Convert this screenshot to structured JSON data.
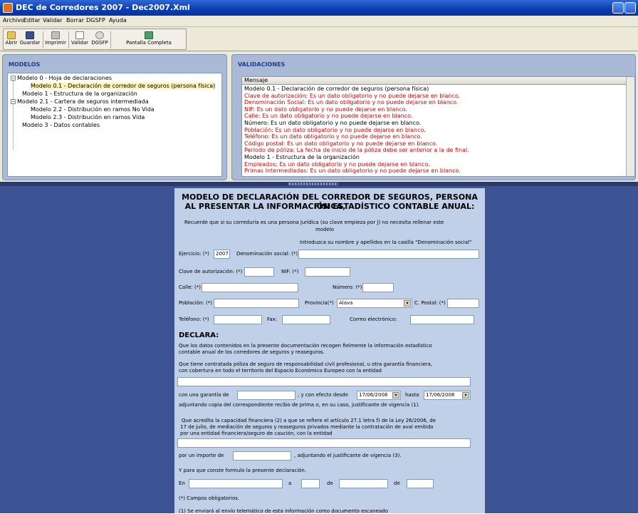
{
  "window": {
    "title": "DEC de Corredores 2007 - Dec2007.Xml"
  },
  "menu": [
    "Archivo",
    "Editar",
    "Validar",
    "Borrar",
    "DGSFP",
    "Ayuda"
  ],
  "toolbar": [
    "Abrir",
    "Guardar",
    "Imprimir",
    "Validar",
    "DGSFP",
    "Pantalla Completa"
  ],
  "modelos": {
    "header": "MODELOS",
    "items": [
      "Modelo 0 - Hoja de declaraciones",
      "Modelo 0.1 - Declaración de corredor de seguros (persona física)",
      "Modelo 1 - Estructura de la organización",
      "Modelo 2.1 - Cartera de seguros intermediada",
      "Modelo 2.2 - Distribución en ramos No Vida",
      "Modelo 2.3 - Distribución en ramos Vida",
      "Modelo 3 - Datos contables"
    ]
  },
  "validaciones": {
    "header": "VALIDACIONES",
    "column": "Mensaje",
    "rows": [
      {
        "text": "Modelo 0.1 - Declaración de corredor de seguros (persona física)",
        "color": "#000000"
      },
      {
        "text": "Clave de autorización: Es un dato obligatorio y no puede dejarse en blanco.",
        "color": "#e00000"
      },
      {
        "text": "Denominación Social: Es un dato obligatorio y no puede dejarse en blanco.",
        "color": "#e00000"
      },
      {
        "text": "NIF: Es un dato obligatorio y no puede dejarse en blanco.",
        "color": "#e00000"
      },
      {
        "text": "Calle: Es un dato obligatorio y no puede dejarse en blanco.",
        "color": "#e00000"
      },
      {
        "text": "Número: Es un dato obligatorio y no puede dejarse en blanco.",
        "color": "#000000"
      },
      {
        "text": "Población: Es un dato obligatorio y no puede dejarse en blanco.",
        "color": "#e00000"
      },
      {
        "text": "Teléfono: Es un dato obligatorio y no puede dejarse en blanco.",
        "color": "#e00000"
      },
      {
        "text": "Código postal: Es un dato obligatorio y no puede dejarse en blanco.",
        "color": "#e00000"
      },
      {
        "text": "Periodo de póliza: La fecha de inicio de la póliza debe ser anterior a la de final.",
        "color": "#e00000"
      },
      {
        "text": "Modelo 1 - Estructura de la organización",
        "color": "#000000"
      },
      {
        "text": "Empleados: Es un dato obligatorio y no puede dejarse en blanco.",
        "color": "#e00000"
      },
      {
        "text": "Primas Intermediadas: Es un dato obligatorio y no puede dejarse en blanco.",
        "color": "#e00000"
      }
    ]
  },
  "form": {
    "title1": "MODELO DE DECLARACIÓN DEL CORREDOR DE SEGUROS, PERSONA FÍSICA,",
    "title2": "AL PRESENTAR LA INFORMACIÓN ESTADÍSTICO CONTABLE ANUAL:",
    "note1": "Recuerde que si su correduría es una persona jurídica (su clave empieza por J) no necesita rellenar este",
    "note2": "modelo",
    "hint": "Introduzca su nombre y apellidos en la casilla \"Denominación social\"",
    "ejercicio_label": "Ejercicio: (*)",
    "ejercicio_value": "2007",
    "denominacion_label": "Denominación social: (*)",
    "clave_label": "Clave de autorización: (*)",
    "nif_label": "NIF: (*)",
    "calle_label": "Calle: (*)",
    "numero_label": "Número: (*)",
    "poblacion_label": "Población: (*)",
    "provincia_label": "Provincia(*)",
    "provincia_value": "Alava",
    "cpostal_label": "C. Postal: (*)",
    "telefono_label": "Teléfono: (*)",
    "fax_label": "Fax:",
    "correo_label": "Correo electrónico:",
    "declara": "DECLARA:",
    "p1a": "Que los datos contenidos en la presente documentación recogen fielmente la información estadístico",
    "p1b": "contable anual de los corredores de seguros y reaseguros.",
    "p2a": "Que tiene contratada póliza de seguro de responsabilidad civil profesional, u otra garantía financiera,",
    "p2b": "con cobertura en todo el territorio del Espacio Económico Europeo con la entidad",
    "garantia_label": "con una garantía de",
    "efecto_label": ", y con efecto desde",
    "date_from": "17/06/2008",
    "hasta_label": "hasta",
    "date_to": "17/06/2008",
    "adjuntando": "adjuntando copia del correspondiente recibo de prima o, en su caso, justificante de vigencia (1).",
    "p3a": "Que acredita la capacidad financiera (2) a que se refiere el artículo 27.1 letra f) de la Ley 26/2006, de",
    "p3b": "17 de julio, de mediación de seguros y reaseguros privados mediante la contratación de aval emitido",
    "p3c": "por una entidad financiera/seguro de caución, con la entidad",
    "importe_label": "por un importe de",
    "importe_suffix": ", adjuntando el justificante de vigencia (3).",
    "conste": "Y para que conste formulo la presente declaración.",
    "en_label": "En",
    "a_label": "a",
    "de1_label": "de",
    "de2_label": "de",
    "obligatorios": "(*) Campos obligatorios.",
    "footnote": "(1) Se enviará al envío telemático de esta información como documento escaneado"
  }
}
